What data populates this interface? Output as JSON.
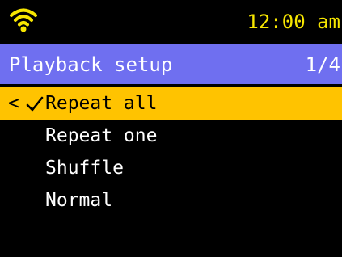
{
  "status": {
    "time": "12:00 am",
    "wifi_icon": "wifi-icon",
    "accent_color": "#f7e600"
  },
  "header": {
    "title": "Playback setup",
    "page": "1/4",
    "background_color": "#6f6ff0"
  },
  "menu": {
    "selection_marker": "<",
    "selected_icon": "checkmark-icon",
    "highlight_color": "#ffc300",
    "items": [
      {
        "label": "Repeat all",
        "selected": true,
        "checked": true
      },
      {
        "label": "Repeat one",
        "selected": false,
        "checked": false
      },
      {
        "label": "Shuffle",
        "selected": false,
        "checked": false
      },
      {
        "label": "Normal",
        "selected": false,
        "checked": false
      }
    ]
  }
}
